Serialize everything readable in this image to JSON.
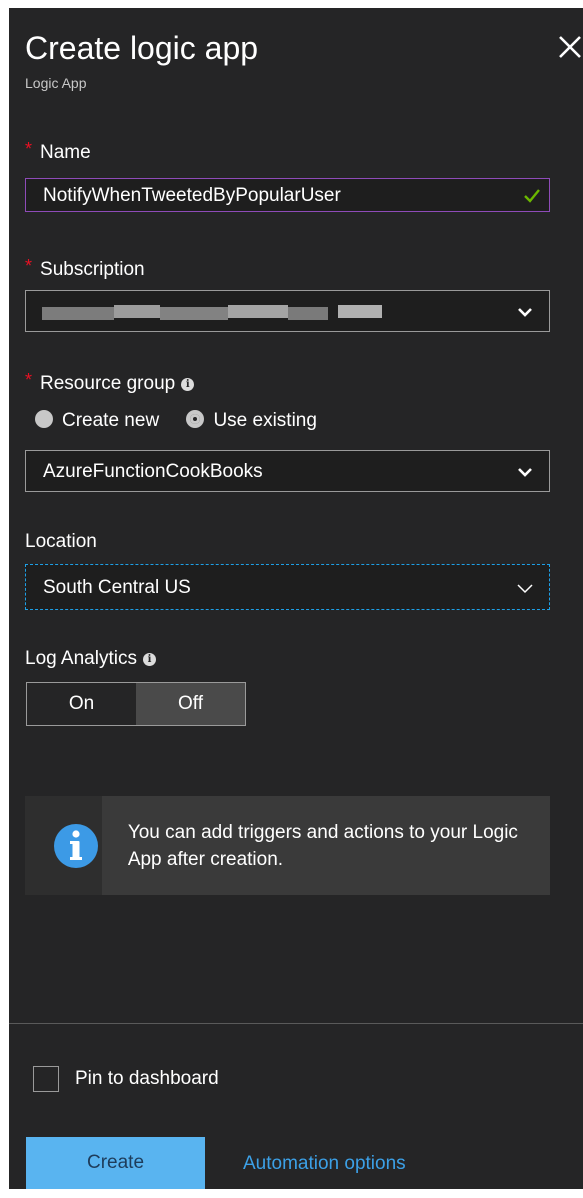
{
  "header": {
    "title": "Create logic app",
    "subtitle": "Logic App"
  },
  "name_field": {
    "label": "Name",
    "value": "NotifyWhenTweetedByPopularUser",
    "valid": true
  },
  "subscription": {
    "label": "Subscription",
    "value_redacted": true
  },
  "resource_group": {
    "label": "Resource group",
    "options": [
      "Create new",
      "Use existing"
    ],
    "selected_option": "Use existing",
    "value": "AzureFunctionCookBooks"
  },
  "location": {
    "label": "Location",
    "value": "South Central US"
  },
  "log_analytics": {
    "label": "Log Analytics",
    "on_label": "On",
    "off_label": "Off",
    "selected": "Off"
  },
  "info_box": {
    "message": "You can add triggers and actions to your Logic App after creation."
  },
  "footer": {
    "pin_label": "Pin to dashboard",
    "pin_checked": false,
    "create_label": "Create",
    "automation_label": "Automation options"
  },
  "colors": {
    "panel_bg": "#252526",
    "required_star": "#e81123",
    "valid_check": "#6bb700",
    "name_field_border": "#8e4bb8",
    "location_focus_border": "#1ea0e6",
    "primary_button": "#59b4f0",
    "link": "#3ca0e6",
    "info_icon": "#3c9ae6"
  },
  "icons": {
    "close": "close-icon",
    "valid": "checkmark-icon",
    "dropdown": "chevron-down-icon",
    "info": "info-icon"
  }
}
